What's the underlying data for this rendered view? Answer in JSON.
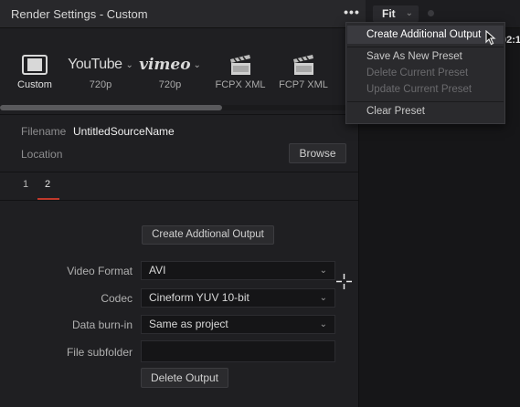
{
  "window": {
    "title": "Render Settings - Custom",
    "more_label": "•••"
  },
  "viewer": {
    "fit_label": "Fit",
    "timecode": "02:1"
  },
  "presets": [
    {
      "label": "Custom",
      "icon": "film-strip-icon",
      "active": true
    },
    {
      "label": "720p",
      "brand": "YouTube",
      "icon": "youtube-logo"
    },
    {
      "label": "720p",
      "brand": "vimeo",
      "icon": "vimeo-logo"
    },
    {
      "label": "FCPX XML",
      "icon": "clapperboard-icon"
    },
    {
      "label": "FCP7 XML",
      "icon": "clapperboard-icon"
    }
  ],
  "file": {
    "filename_label": "Filename",
    "filename_value": "UntitledSourceName",
    "location_label": "Location",
    "browse_label": "Browse"
  },
  "tabs": [
    {
      "label": "1"
    },
    {
      "label": "2",
      "active": true
    }
  ],
  "output": {
    "create_button": "Create Addtional Output",
    "video_format_label": "Video Format",
    "video_format_value": "AVI",
    "codec_label": "Codec",
    "codec_value": "Cineform YUV 10-bit",
    "data_burnin_label": "Data burn-in",
    "data_burnin_value": "Same as project",
    "file_subfolder_label": "File subfolder",
    "file_subfolder_value": "",
    "delete_button": "Delete Output"
  },
  "menu": {
    "items": [
      {
        "label": "Create Additional Output",
        "state": "highlighted"
      },
      {
        "label": "Save As New Preset",
        "state": "enabled"
      },
      {
        "label": "Delete Current Preset",
        "state": "disabled"
      },
      {
        "label": "Update Current Preset",
        "state": "disabled"
      },
      {
        "label": "Clear Preset",
        "state": "enabled"
      }
    ]
  },
  "colors": {
    "accent_tab": "#c0392b",
    "panel_bg": "#1f1f22",
    "menu_bg": "#2a2a2d"
  }
}
